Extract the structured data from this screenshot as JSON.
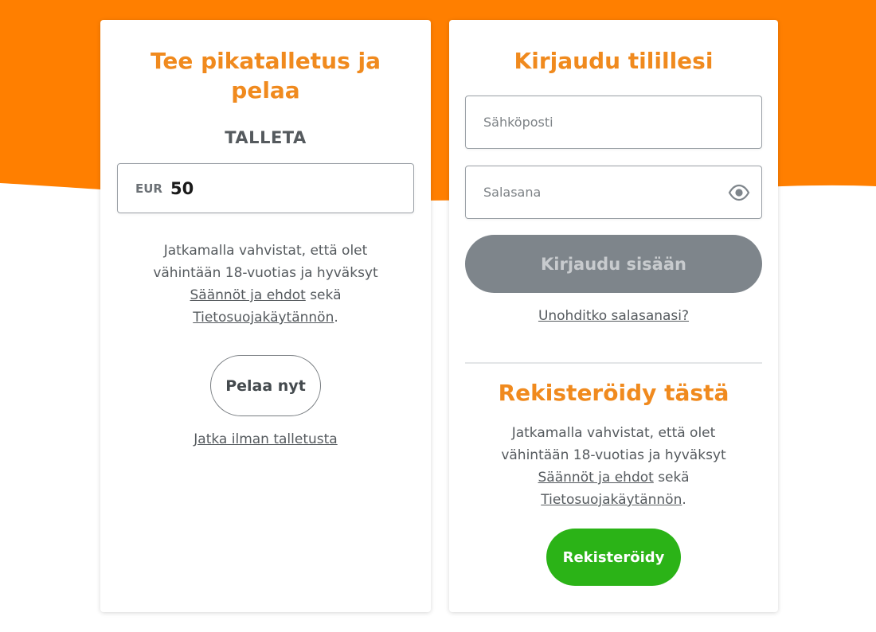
{
  "quick_deposit": {
    "title_line1": "Tee pikatalletus ja",
    "title_line2": "pelaa",
    "deposit_label": "TALLETA",
    "currency": "EUR",
    "amount": "50",
    "terms_line1": "Jatkamalla vahvistat, että olet",
    "terms_line2": "vähintään 18-vuotias ja hyväksyt",
    "terms_link": "Säännöt ja ehdot",
    "terms_and": " sekä",
    "privacy_link": "Tietosuojakäytännön",
    "period": ".",
    "play_button": "Pelaa nyt",
    "continue_link": "Jatka ilman talletusta"
  },
  "login": {
    "title": "Kirjaudu tilillesi",
    "email_placeholder": "Sähköposti",
    "password_placeholder": "Salasana",
    "login_button": "Kirjaudu sisään",
    "forgot_link": "Unohditko salasanasi?"
  },
  "register": {
    "title": "Rekisteröidy tästä",
    "terms_line1": "Jatkamalla vahvistat, että olet",
    "terms_line2": "vähintään 18-vuotias ja hyväksyt",
    "terms_link": "Säännöt ja ehdot",
    "terms_and": " sekä",
    "privacy_link": "Tietosuojakäytännön",
    "period": ".",
    "register_button": "Rekisteröidy"
  },
  "colors": {
    "brand_orange": "#ff7f00",
    "title_orange": "#f08a1e",
    "register_green": "#2bb317",
    "disabled_gray": "#7e858b"
  },
  "icons": {
    "password_toggle": "eye-icon"
  }
}
